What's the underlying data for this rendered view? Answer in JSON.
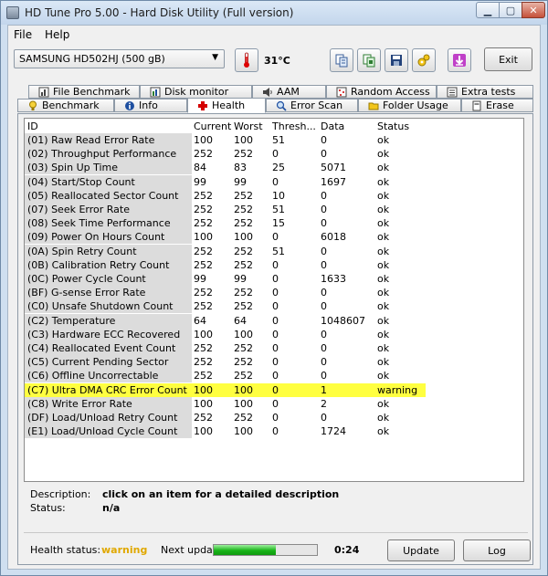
{
  "window": {
    "title": "HD Tune Pro 5.00 - Hard Disk Utility (Full version)"
  },
  "menu": {
    "file": "File",
    "help": "Help"
  },
  "toolbar": {
    "drive": "SAMSUNG HD502HJ (500 gB)",
    "temperature": "31°C",
    "exit_label": "Exit",
    "icons": [
      "thermometer-icon",
      "copy-info-icon",
      "copy-screen-icon",
      "save-icon",
      "options-icon",
      "download-icon"
    ]
  },
  "tabs": {
    "row1": [
      "File Benchmark",
      "Disk monitor",
      "AAM",
      "Random Access",
      "Extra tests"
    ],
    "row2": [
      "Benchmark",
      "Info",
      "Health",
      "Error Scan",
      "Folder Usage",
      "Erase"
    ],
    "active": "Health"
  },
  "table": {
    "columns": [
      "ID",
      "Current",
      "Worst",
      "Thresh...",
      "Data",
      "Status"
    ],
    "rows": [
      [
        "(01) Raw Read Error Rate",
        "100",
        "100",
        "51",
        "0",
        "ok"
      ],
      [
        "(02) Throughput Performance",
        "252",
        "252",
        "0",
        "0",
        "ok"
      ],
      [
        "(03) Spin Up Time",
        "84",
        "83",
        "25",
        "5071",
        "ok"
      ],
      [
        "(04) Start/Stop Count",
        "99",
        "99",
        "0",
        "1697",
        "ok"
      ],
      [
        "(05) Reallocated Sector Count",
        "252",
        "252",
        "10",
        "0",
        "ok"
      ],
      [
        "(07) Seek Error Rate",
        "252",
        "252",
        "51",
        "0",
        "ok"
      ],
      [
        "(08) Seek Time Performance",
        "252",
        "252",
        "15",
        "0",
        "ok"
      ],
      [
        "(09) Power On Hours Count",
        "100",
        "100",
        "0",
        "6018",
        "ok"
      ],
      [
        "(0A) Spin Retry Count",
        "252",
        "252",
        "51",
        "0",
        "ok"
      ],
      [
        "(0B) Calibration Retry Count",
        "252",
        "252",
        "0",
        "0",
        "ok"
      ],
      [
        "(0C) Power Cycle Count",
        "99",
        "99",
        "0",
        "1633",
        "ok"
      ],
      [
        "(BF) G-sense Error Rate",
        "252",
        "252",
        "0",
        "0",
        "ok"
      ],
      [
        "(C0) Unsafe Shutdown Count",
        "252",
        "252",
        "0",
        "0",
        "ok"
      ],
      [
        "(C2) Temperature",
        "64",
        "64",
        "0",
        "1048607",
        "ok"
      ],
      [
        "(C3) Hardware ECC Recovered",
        "100",
        "100",
        "0",
        "0",
        "ok"
      ],
      [
        "(C4) Reallocated Event Count",
        "252",
        "252",
        "0",
        "0",
        "ok"
      ],
      [
        "(C5) Current Pending Sector",
        "252",
        "252",
        "0",
        "0",
        "ok"
      ],
      [
        "(C6) Offline Uncorrectable",
        "252",
        "252",
        "0",
        "0",
        "ok"
      ],
      [
        "(C7) Ultra DMA CRC Error Count",
        "100",
        "100",
        "0",
        "1",
        "warning"
      ],
      [
        "(C8) Write Error Rate",
        "100",
        "100",
        "0",
        "2",
        "ok"
      ],
      [
        "(DF) Load/Unload Retry Count",
        "252",
        "252",
        "0",
        "0",
        "ok"
      ],
      [
        "(E1) Load/Unload Cycle Count",
        "100",
        "100",
        "0",
        "1724",
        "ok"
      ]
    ],
    "highlight_color": "#ffff40"
  },
  "details": {
    "description_label": "Description:",
    "description_value": "click on an item for a detailed description",
    "status_label": "Status:",
    "status_value": "n/a"
  },
  "footer": {
    "health_label": "Health status:",
    "health_value": "warning",
    "health_color": "#e0a800",
    "next_update_label": "Next update:",
    "progress_fraction": 0.6,
    "countdown": "0:24",
    "update_label": "Update",
    "log_label": "Log"
  }
}
